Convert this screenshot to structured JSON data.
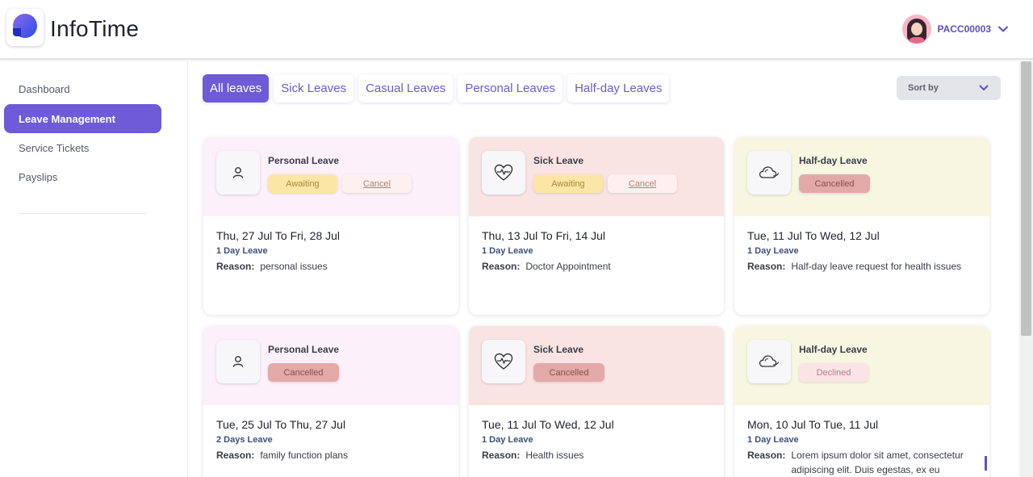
{
  "header": {
    "app_title": "InfoTime",
    "user_id": "PACC00003",
    "logo_icon": "infotime-logo",
    "chevron_icon": "chevron-down-icon"
  },
  "sidebar": {
    "items": [
      {
        "label": "Dashboard",
        "active": false
      },
      {
        "label": "Leave Management",
        "active": true
      },
      {
        "label": "Service Tickets",
        "active": false
      },
      {
        "label": "Payslips",
        "active": false
      }
    ]
  },
  "tabs": [
    {
      "label": "All leaves",
      "active": true
    },
    {
      "label": "Sick Leaves",
      "active": false
    },
    {
      "label": "Casual Leaves",
      "active": false
    },
    {
      "label": "Personal Leaves",
      "active": false
    },
    {
      "label": "Half-day Leaves",
      "active": false
    }
  ],
  "sort": {
    "label": "Sort by"
  },
  "colors": {
    "accent": "#6f5ad8",
    "personal_bg": "#fcf0fb",
    "sick_bg": "#f9e3e3",
    "halfday_bg": "#f7f7e1"
  },
  "cards": [
    {
      "type": "Personal Leave",
      "icon": "person-icon",
      "badges": [
        {
          "label": "Awaiting",
          "kind": "awaiting"
        },
        {
          "label": "Cancel",
          "kind": "cancel"
        }
      ],
      "dates": "Thu, 27 Jul To Fri, 28 Jul",
      "duration": "1 Day Leave",
      "reason_label": "Reason:",
      "reason": "personal issues"
    },
    {
      "type": "Sick Leave",
      "icon": "heartbeat-icon",
      "badges": [
        {
          "label": "Awaiting",
          "kind": "awaiting"
        },
        {
          "label": "Cancel",
          "kind": "cancel"
        }
      ],
      "dates": "Thu, 13 Jul To Fri, 14 Jul",
      "duration": "1 Day Leave",
      "reason_label": "Reason:",
      "reason": "Doctor Appointment"
    },
    {
      "type": "Half-day Leave",
      "icon": "cloud-icon",
      "badges": [
        {
          "label": "Cancelled",
          "kind": "cancelled"
        }
      ],
      "dates": "Tue, 11 Jul To Wed, 12 Jul",
      "duration": "1 Day Leave",
      "reason_label": "Reason:",
      "reason": "Half-day leave request for health issues"
    },
    {
      "type": "Personal Leave",
      "icon": "person-icon",
      "badges": [
        {
          "label": "Cancelled",
          "kind": "cancelled"
        }
      ],
      "dates": "Tue, 25 Jul To Thu, 27 Jul",
      "duration": "2 Days Leave",
      "reason_label": "Reason:",
      "reason": "family function plans"
    },
    {
      "type": "Sick Leave",
      "icon": "heartbeat-icon",
      "badges": [
        {
          "label": "Cancelled",
          "kind": "cancelled"
        }
      ],
      "dates": "Tue, 11 Jul To Wed, 12 Jul",
      "duration": "1 Day Leave",
      "reason_label": "Reason:",
      "reason": "Health issues"
    },
    {
      "type": "Half-day Leave",
      "icon": "cloud-icon",
      "badges": [
        {
          "label": "Declined",
          "kind": "declined"
        }
      ],
      "dates": "Mon, 10 Jul To Tue, 11 Jul",
      "duration": "1 Day Leave",
      "reason_label": "Reason:",
      "reason": "Lorem ipsum dolor sit amet, consectetur adipiscing elit. Duis egestas, ex eu"
    }
  ]
}
